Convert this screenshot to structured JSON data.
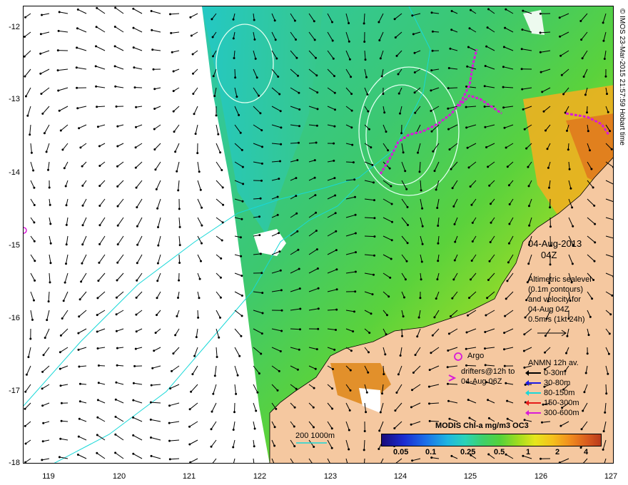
{
  "map": {
    "date": "04-Aug-2013",
    "time": "04Z",
    "altimetry_lines": [
      "Altimetric sealevel",
      "(0.1m contours)",
      "and velocity for",
      "04-Aug 04Z",
      "0.5m/s (1kt 24h)"
    ],
    "argo_label": "Argo",
    "drifters_lines": [
      "drifters@12h to",
      "04-Aug 06Z"
    ],
    "anmn_title": "ANMN 12h av.",
    "anmn_items": [
      {
        "label": "0-30m",
        "color": "#000000"
      },
      {
        "label": "30-80m",
        "color": "#1a1ae6"
      },
      {
        "label": "80-150m",
        "color": "#18d8d8"
      },
      {
        "label": "150-300m",
        "color": "#e61a1a"
      },
      {
        "label": "300-600m",
        "color": "#d81ad8"
      }
    ],
    "colorbar_title": "MODIS Chl-a mg/m3 OC3",
    "colorbar_ticks": [
      "0.05",
      "0.1",
      "0.25",
      "0.5",
      "1",
      "2",
      "4"
    ],
    "depth_label": "200  1000m",
    "credit": "© IMOS 23-Mar-2015 21:57:59 Hobart time",
    "lat_ticks": [
      "-12",
      "-13",
      "-14",
      "-15",
      "-16",
      "-17",
      "-18"
    ],
    "lon_ticks": [
      "119",
      "120",
      "121",
      "122",
      "123",
      "124",
      "125",
      "126",
      "127"
    ],
    "colors": {
      "land": "#f5c8a0",
      "ocean_low": "#22c8c8",
      "ocean_mid": "#55d23a",
      "ocean_high": "#e6e61c",
      "coastal_high": "#f08c1e",
      "contour": "#e0fff0",
      "isobath": "#18d8d8",
      "drifter": "#d81ad8"
    }
  }
}
